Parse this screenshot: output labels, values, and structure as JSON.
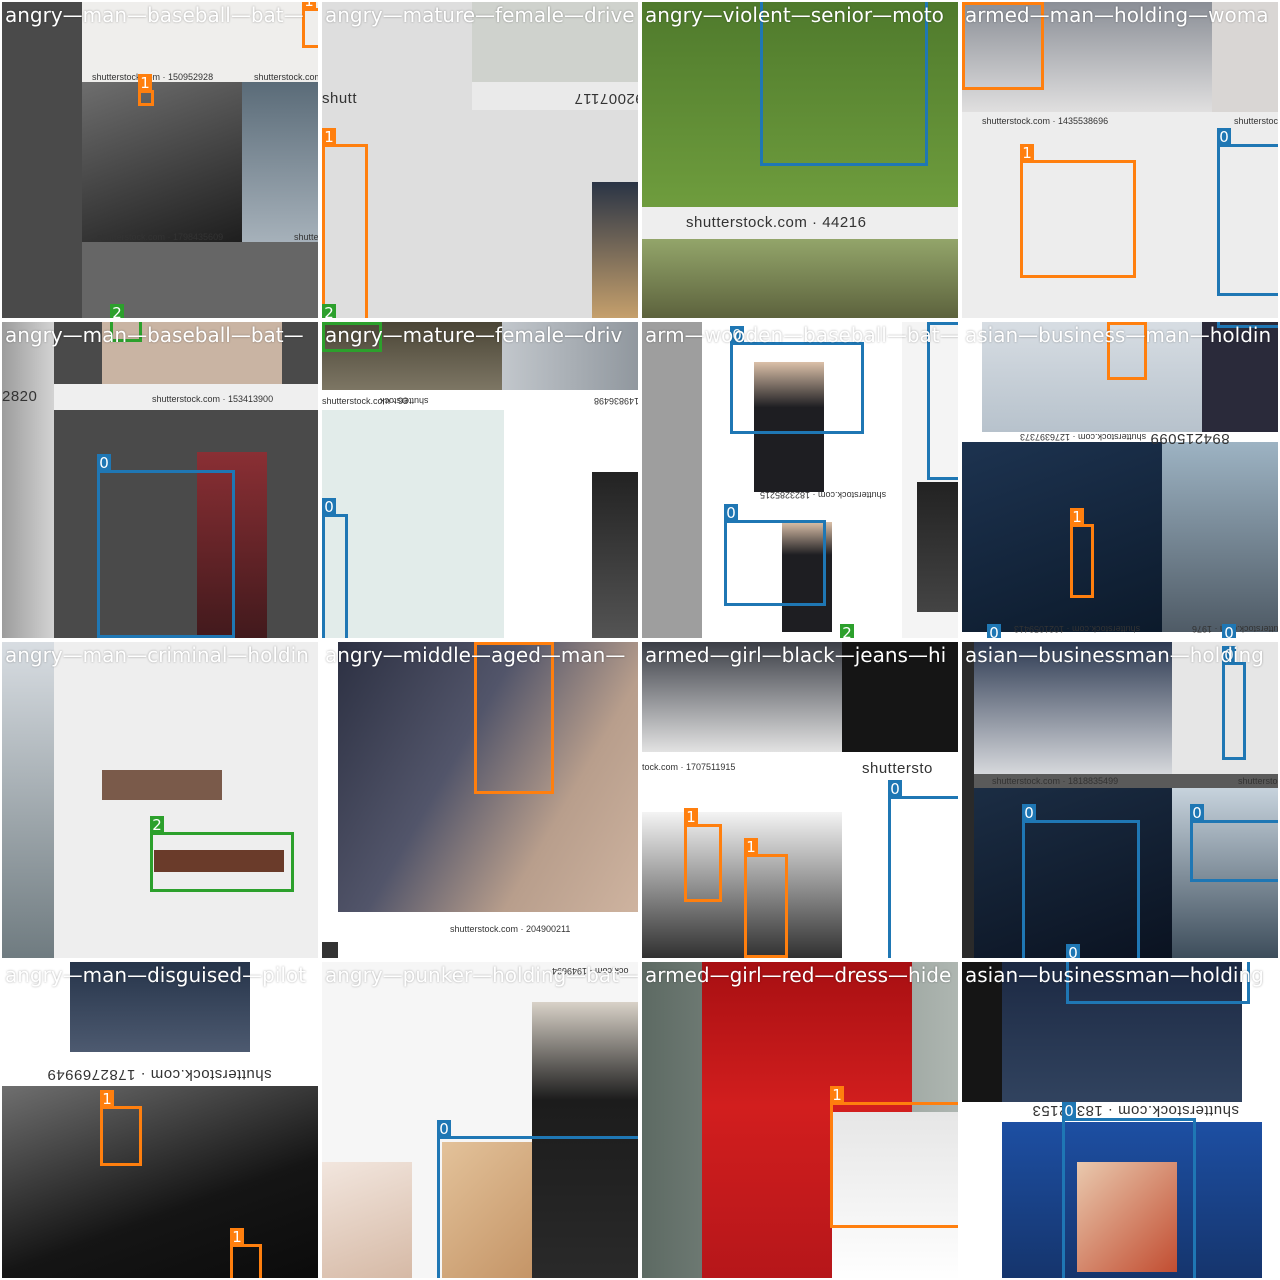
{
  "class_colors": {
    "0": "#1f77b4",
    "1": "#ff7f0e",
    "2": "#2ca02c"
  },
  "tiles": [
    {
      "filename": "angry—man—baseball—bat—",
      "watermarks": [
        "shutterstock.com · 150952928",
        "shutterstock.com",
        "shutterstock.com · 1798435609",
        "shutterstock"
      ],
      "boxes": [
        {
          "cls": "1"
        },
        {
          "cls": "1"
        },
        {
          "cls": "2"
        }
      ]
    },
    {
      "filename": "angry—mature—female—drive",
      "watermarks": [
        "shutt",
        "92007117"
      ],
      "boxes": [
        {
          "cls": "1"
        },
        {
          "cls": "2"
        }
      ]
    },
    {
      "filename": "angry—violent—senior—moto",
      "watermarks": [
        "shutterstock.com · 44216"
      ],
      "boxes": [
        {
          "cls": "0"
        }
      ]
    },
    {
      "filename": "armed—man—holding—woma",
      "watermarks": [
        "shutterstock.com · 1435538696",
        "shutterstock.com"
      ],
      "boxes": [
        {
          "cls": "1"
        },
        {
          "cls": "1"
        },
        {
          "cls": "0"
        }
      ]
    },
    {
      "filename": "angry—man—baseball—bat—",
      "watermarks": [
        "2820",
        "shutterstock.com · 153413900"
      ],
      "boxes": [
        {
          "cls": "2"
        },
        {
          "cls": "0"
        }
      ]
    },
    {
      "filename": "angry—mature—female—driv",
      "watermarks": [
        "shutterstock.com · 93",
        "shutterstock",
        "149836498"
      ],
      "boxes": [
        {
          "cls": "2"
        },
        {
          "cls": "0"
        }
      ]
    },
    {
      "filename": "arm—wooden—baseball—bat—",
      "watermarks": [
        "shutterstock.com · 1823285215"
      ],
      "boxes": [
        {
          "cls": "0"
        },
        {
          "cls": "0"
        },
        {
          "cls": "0"
        },
        {
          "cls": "2"
        }
      ]
    },
    {
      "filename": "asian—business—man—holdin",
      "watermarks": [
        "shutterstock.com · 1276397373",
        "894215099",
        "shutterstock.com · 1021059413",
        "shutterstock.com · 1976"
      ],
      "boxes": [
        {
          "cls": "1"
        },
        {
          "cls": "0"
        },
        {
          "cls": "1"
        },
        {
          "cls": "0"
        },
        {
          "cls": "0"
        }
      ]
    },
    {
      "filename": "angry—man—criminal—holdin",
      "watermarks": [],
      "boxes": [
        {
          "cls": "2"
        }
      ]
    },
    {
      "filename": "angry—middle—aged—man—",
      "watermarks": [
        "shutterstock.com · 204900211"
      ],
      "boxes": [
        {
          "cls": "1"
        }
      ]
    },
    {
      "filename": "armed—girl—black—jeans—hi",
      "watermarks": [
        "tock.com · 1707511915",
        "shuttersto"
      ],
      "boxes": [
        {
          "cls": "1"
        },
        {
          "cls": "1"
        },
        {
          "cls": "0"
        }
      ]
    },
    {
      "filename": "asian—businessman—holding",
      "watermarks": [
        "shutterstock.com · 1818835499",
        "shutterstock"
      ],
      "boxes": [
        {
          "cls": "0"
        },
        {
          "cls": "0"
        },
        {
          "cls": "0"
        },
        {
          "cls": "0"
        }
      ]
    },
    {
      "filename": "angry—man—disguised—pilot",
      "watermarks": [
        "shutterstock.com · 1782769949"
      ],
      "boxes": [
        {
          "cls": "1"
        },
        {
          "cls": "1"
        }
      ]
    },
    {
      "filename": "angry—punker—holding—bat—",
      "watermarks": [
        "ock.com · 1949694"
      ],
      "boxes": [
        {
          "cls": "0"
        }
      ]
    },
    {
      "filename": "armed—girl—red—dress—hide",
      "watermarks": [],
      "boxes": [
        {
          "cls": "1"
        }
      ]
    },
    {
      "filename": "asian—businessman—holding",
      "watermarks": [
        "shutterstock.com · 18362153"
      ],
      "boxes": [
        {
          "cls": "0"
        },
        {
          "cls": "0"
        }
      ]
    }
  ]
}
